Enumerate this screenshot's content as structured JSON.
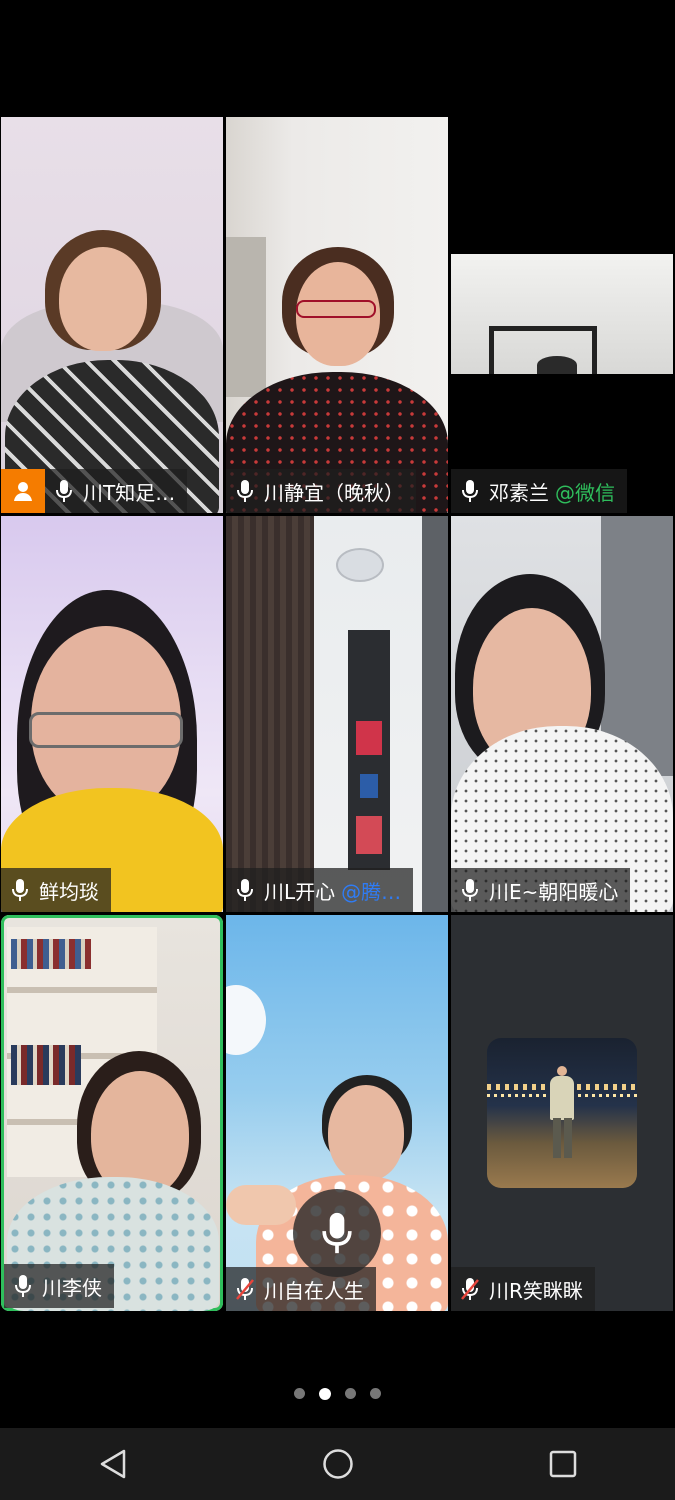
{
  "participants": [
    {
      "name": "川T知足…",
      "mic": "on",
      "host": true
    },
    {
      "name": "川静宜（晚秋）",
      "mic": "on"
    },
    {
      "name": "邓素兰",
      "suffix": "@微信",
      "mic": "on"
    },
    {
      "name": "鲜均琰",
      "mic": "on"
    },
    {
      "name": "川L开心",
      "suffix": "@腾…",
      "mic": "on"
    },
    {
      "name": "川E~朝阳暖心",
      "mic": "on"
    },
    {
      "name": "川李侠",
      "mic": "on",
      "speaking": true
    },
    {
      "name": "川自在人生",
      "mic": "muted"
    },
    {
      "name": "川R笑眯眯",
      "mic": "muted",
      "video": "off"
    }
  ],
  "pagination": {
    "pages": 4,
    "current": 2
  },
  "colors": {
    "active_speaker": "#2fbe5c",
    "host_badge": "#f57c00",
    "wechat": "#2fbe5c",
    "tencent": "#2f7cf5"
  },
  "icons": [
    "mic-icon",
    "mic-muted-icon",
    "host-icon",
    "back-icon",
    "home-icon",
    "recents-icon"
  ]
}
